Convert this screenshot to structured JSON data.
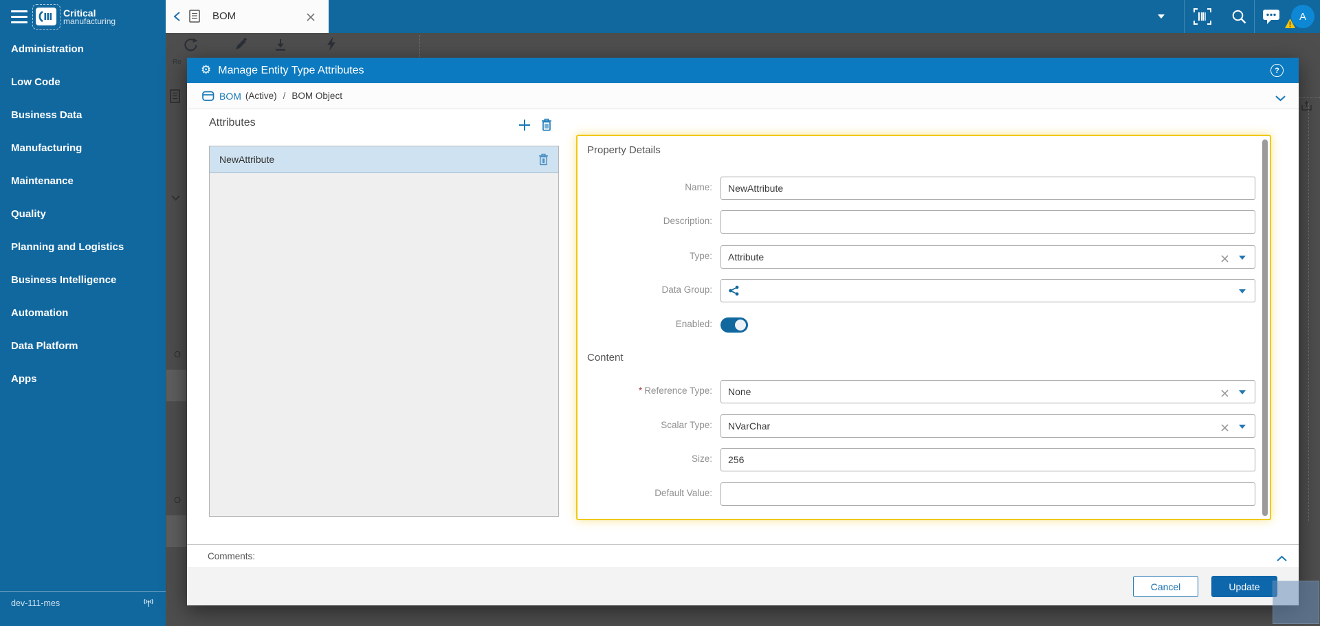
{
  "app": {
    "logo_title": "Critical",
    "logo_subtitle": "manufacturing"
  },
  "topbar": {
    "tab": {
      "label": "BOM"
    },
    "avatar_initial": "A",
    "icons": [
      "caret-down-icon",
      "barcode-scan-icon",
      "search-icon",
      "chat-icon",
      "avatar",
      "warning-badge-icon"
    ]
  },
  "sidebar": {
    "items": [
      "Administration",
      "Low Code",
      "Business Data",
      "Manufacturing",
      "Maintenance",
      "Quality",
      "Planning and Logistics",
      "Business Intelligence",
      "Automation",
      "Data Platform",
      "Apps"
    ],
    "environment": "dev-111-mes"
  },
  "background_fragments": {
    "refresh_label": "Re",
    "partial_text_1": "O",
    "partial_text_2": "O"
  },
  "dialog": {
    "title": "Manage Entity Type Attributes",
    "help_glyph": "?",
    "gear_glyph": "⚙",
    "breadcrumb": {
      "entity": "BOM",
      "state": "(Active)",
      "separator": "/",
      "object": "BOM Object"
    },
    "attributes": {
      "title": "Attributes",
      "items": [
        {
          "name": "NewAttribute",
          "selected": true
        }
      ]
    },
    "properties": {
      "title": "Property Details",
      "name_label": "Name:",
      "name_value": "NewAttribute",
      "description_label": "Description:",
      "description_value": "",
      "type_label": "Type:",
      "type_value": "Attribute",
      "data_group_label": "Data Group:",
      "data_group_value": "",
      "enabled_label": "Enabled:",
      "enabled_state": "on",
      "content_title": "Content",
      "required_marker": "*",
      "reference_type_label": "Reference Type:",
      "reference_type_value": "None",
      "scalar_type_label": "Scalar Type:",
      "scalar_type_value": "NVarChar",
      "size_label": "Size:",
      "size_value": "256",
      "default_value_label": "Default Value:",
      "default_value_value": ""
    },
    "comments_label": "Comments:",
    "footer": {
      "cancel_label": "Cancel",
      "update_label": "Update"
    }
  },
  "colors": {
    "brand_blue": "#11689F",
    "dialog_header_blue": "#0B7AC1",
    "selection_blue": "#CFE2F1",
    "highlight_yellow": "#F0C810",
    "link_blue": "#1878B6",
    "avatar_blue": "#0E88D4",
    "update_button_blue": "#0E67AB",
    "required_red": "#A94442"
  }
}
